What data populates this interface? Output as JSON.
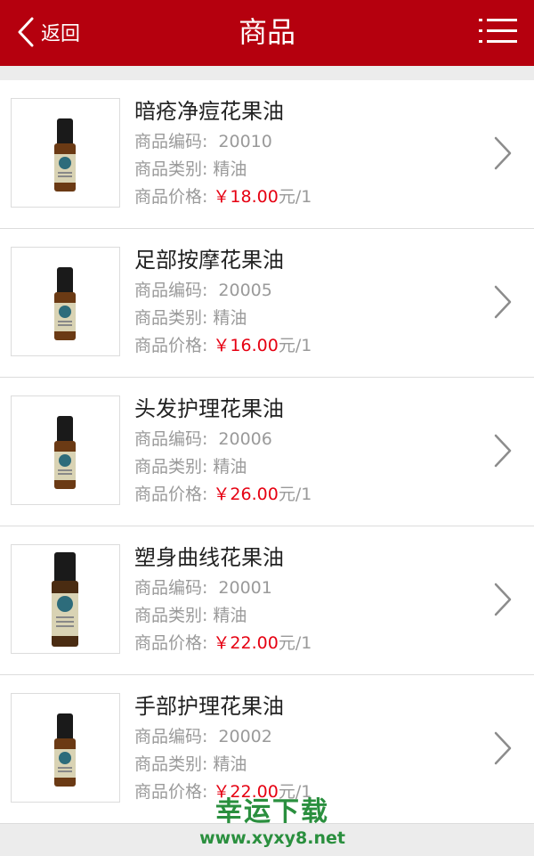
{
  "header": {
    "back_label": "返回",
    "title": "商品",
    "accent_color": "#b5000e"
  },
  "labels": {
    "code": "商品编码:",
    "category": "商品类别:",
    "price": "商品价格:"
  },
  "products": [
    {
      "name": "暗疮净痘花果油",
      "code": "20010",
      "category": "精油",
      "price": "￥18.00",
      "unit": "元/1"
    },
    {
      "name": "足部按摩花果油",
      "code": "20005",
      "category": "精油",
      "price": "￥16.00",
      "unit": "元/1"
    },
    {
      "name": "头发护理花果油",
      "code": "20006",
      "category": "精油",
      "price": "￥26.00",
      "unit": "元/1"
    },
    {
      "name": "塑身曲线花果油",
      "code": "20001",
      "category": "精油",
      "price": "￥22.00",
      "unit": "元/1"
    },
    {
      "name": "手部护理花果油",
      "code": "20002",
      "category": "精油",
      "price": "￥22.00",
      "unit": "元/1"
    }
  ],
  "watermark": {
    "text": "幸运下载",
    "url": "www.xyxy8.net"
  }
}
